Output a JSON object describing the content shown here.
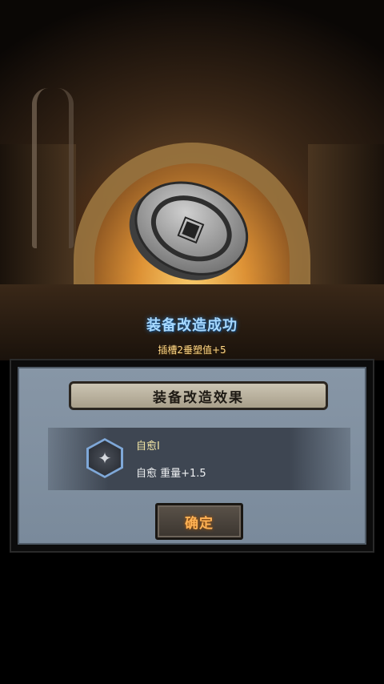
{
  "result": {
    "title": "装备改造成功",
    "subtitle": "插槽2垂塑值+5"
  },
  "panel": {
    "header": "装备改造效果",
    "effect": {
      "name": "自愈I",
      "description": "自愈 重量+1.5",
      "icon": "sparkle-hex-icon"
    },
    "confirm_label": "确定"
  },
  "colors": {
    "title_blue": "#a6d8ff",
    "subtitle_gold": "#ffd98a",
    "button_text_orange": "#ffb255",
    "effect_name_yellow": "#f3e6a6"
  }
}
